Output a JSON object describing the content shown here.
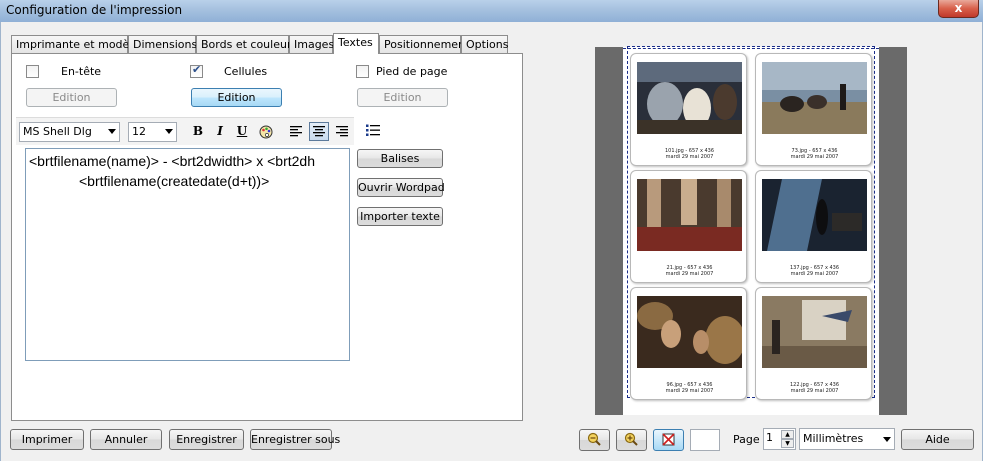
{
  "window": {
    "title": "Configuration de l'impression",
    "close_glyph": "x"
  },
  "tabs": [
    {
      "label": "Imprimante et modèles",
      "active": false
    },
    {
      "label": "Dimensions",
      "active": false
    },
    {
      "label": "Bords et couleurs",
      "active": false
    },
    {
      "label": "Images",
      "active": false
    },
    {
      "label": "Textes",
      "active": true
    },
    {
      "label": "Positionnement",
      "active": false
    },
    {
      "label": "Options",
      "active": false
    }
  ],
  "textes": {
    "header": {
      "label": "En-tête",
      "checked": false,
      "button": "Edition"
    },
    "cells": {
      "label": "Cellules",
      "checked": true,
      "button": "Edition"
    },
    "footer": {
      "label": "Pied de page",
      "checked": false,
      "button": "Edition"
    },
    "font": {
      "name": "MS Shell Dlg",
      "size": "12"
    },
    "format_buttons": {
      "bold": "B",
      "italic": "I",
      "underline": "U"
    },
    "editor_lines": [
      "<brtfilename(name)> - <brt2dwidth> x <brt2dh",
      "<brtfilename(createdate(d+t))>"
    ],
    "side_buttons": {
      "tags": "Balises",
      "wordpad": "Ouvrir Wordpad",
      "import": "Importer texte"
    }
  },
  "preview": {
    "cards": [
      {
        "line1": "101.jpg - 657 x 436",
        "line2": "mardi 29 mai 2007"
      },
      {
        "line1": "73.jpg - 657 x 436",
        "line2": "mardi 29 mai 2007"
      },
      {
        "line1": "21.jpg - 657 x 436",
        "line2": "mardi 29 mai 2007"
      },
      {
        "line1": "137.jpg - 657 x 436",
        "line2": "mardi 29 mai 2007"
      },
      {
        "line1": "96.jpg - 657 x 436",
        "line2": "mardi 29 mai 2007"
      },
      {
        "line1": "122.jpg - 657 x 436",
        "line2": "mardi 29 mai 2007"
      }
    ]
  },
  "bottom": {
    "print": "Imprimer",
    "cancel": "Annuler",
    "save": "Enregistrer",
    "save_as": "Enregistrer sous",
    "page_label": "Page",
    "page_value": "1",
    "units": "Millimètres",
    "help": "Aide"
  },
  "colors": {
    "accent": "#3c7fb1",
    "titlebar": "#a7c2e0",
    "close": "#c0392b"
  }
}
